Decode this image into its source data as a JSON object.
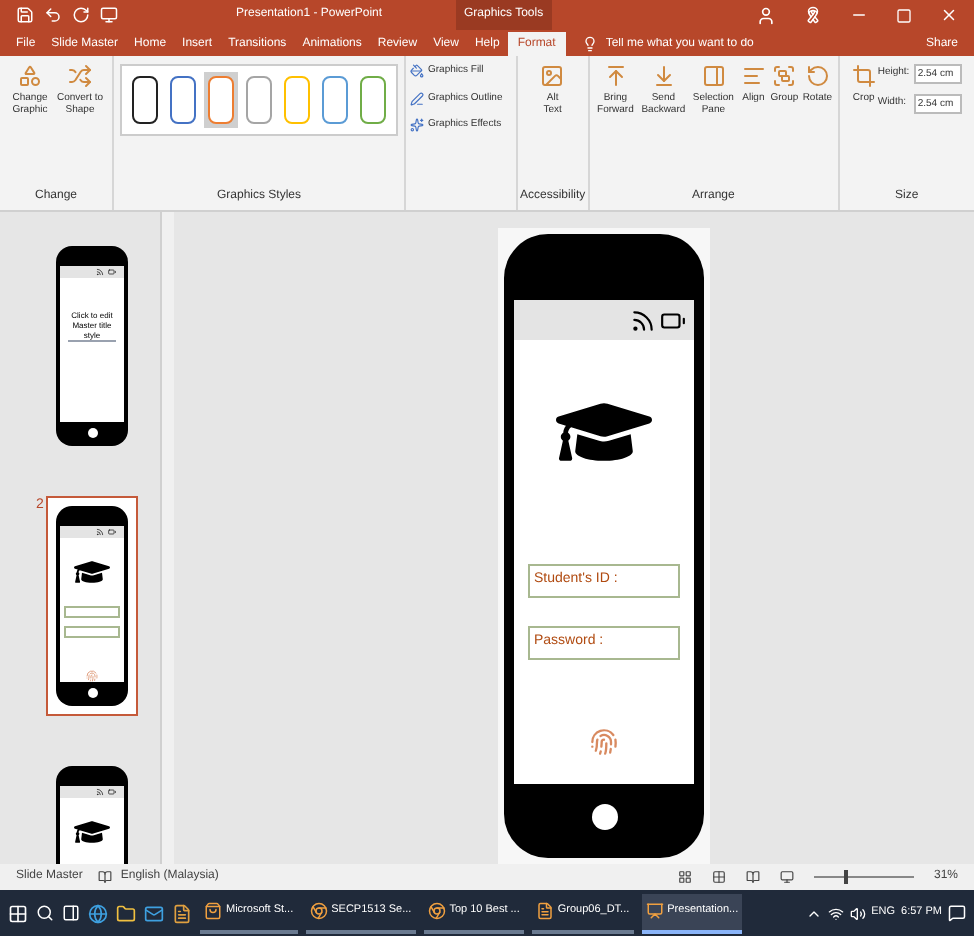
{
  "title_bar": {
    "title": "Presentation1 - PowerPoint",
    "contextual": "Graphics Tools"
  },
  "tabs": [
    {
      "label": "File",
      "selected": false
    },
    {
      "label": "Slide Master",
      "selected": false
    },
    {
      "label": "Home",
      "selected": false
    },
    {
      "label": "Insert",
      "selected": false
    },
    {
      "label": "Transitions",
      "selected": false
    },
    {
      "label": "Animations",
      "selected": false
    },
    {
      "label": "Review",
      "selected": false
    },
    {
      "label": "View",
      "selected": false
    },
    {
      "label": "Help",
      "selected": false
    },
    {
      "label": "Format",
      "selected": true
    }
  ],
  "tell_me": {
    "placeholder": "Tell me what you want to do"
  },
  "share": "Share",
  "ribbon": {
    "change": {
      "buttons": [
        "Change Graphic",
        "Convert to Shape"
      ],
      "label": "Change"
    },
    "styles": {
      "swatches": [
        {
          "color": "#222222",
          "selected": false
        },
        {
          "color": "#4472c4",
          "selected": false
        },
        {
          "color": "#ed7d31",
          "selected": true
        },
        {
          "color": "#a5a5a5",
          "selected": false
        },
        {
          "color": "#ffc000",
          "selected": false
        },
        {
          "color": "#5b9bd5",
          "selected": false
        },
        {
          "color": "#70ad47",
          "selected": false
        }
      ],
      "options": [
        "Graphics Fill",
        "Graphics Outline",
        "Graphics Effects"
      ],
      "label": "Graphics Styles"
    },
    "accessibility": {
      "button": "Alt Text",
      "label": "Accessibility"
    },
    "arrange": {
      "buttons": [
        "Bring Forward",
        "Send Backward",
        "Selection Pane",
        "Align",
        "Group",
        "Rotate"
      ],
      "label": "Arrange"
    },
    "size": {
      "crop": "Crop",
      "height_label": "Height:",
      "height": "2.54 cm",
      "width_label": "Width:",
      "width": "2.54 cm",
      "label": "Size"
    }
  },
  "slides": [
    {
      "title": "Click to edit Master title style",
      "selected": false,
      "kind": "master"
    },
    {
      "number": "2",
      "selected": true,
      "kind": "login"
    },
    {
      "selected": false,
      "kind": "partial"
    }
  ],
  "slide": {
    "fields": [
      "Student's ID :",
      "Password :"
    ]
  },
  "status_bar": {
    "view": "Slide Master",
    "language": "English (Malaysia)",
    "zoom": "31%",
    "level": 0.3
  },
  "taskbar": {
    "apps": [
      {
        "label": "Microsoft St...",
        "selected": false
      },
      {
        "label": "SECP1513 Se...",
        "selected": false
      },
      {
        "label": "Top 10 Best ...",
        "selected": false
      },
      {
        "label": "Group06_DT...",
        "selected": false
      },
      {
        "label": "Presentation...",
        "selected": true
      }
    ],
    "language": "ENG",
    "time": "6:57 PM"
  }
}
